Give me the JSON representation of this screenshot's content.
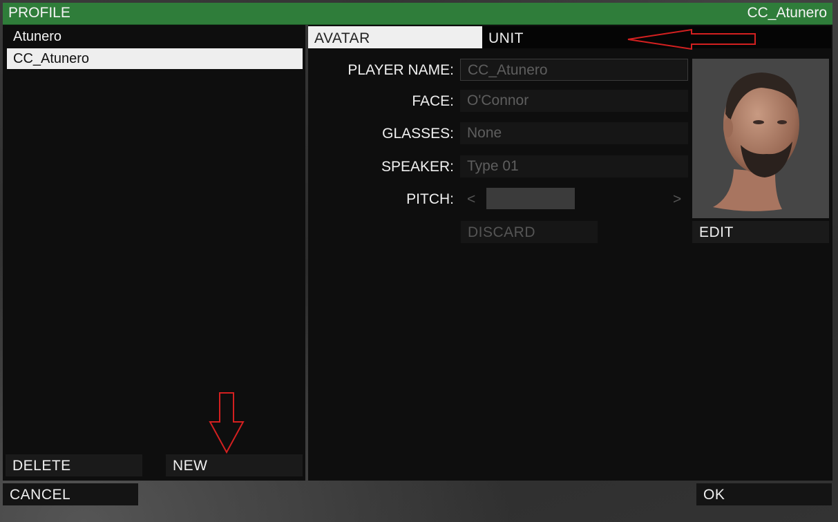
{
  "title": {
    "left": "PROFILE",
    "right": "CC_Atunero"
  },
  "profiles": [
    {
      "name": "Atunero",
      "selected": false
    },
    {
      "name": "CC_Atunero",
      "selected": true
    }
  ],
  "left_buttons": {
    "delete": "DELETE",
    "new": "NEW"
  },
  "tabs": {
    "avatar": "AVATAR",
    "unit": "UNIT"
  },
  "form": {
    "player_name_label": "PLAYER NAME:",
    "player_name_value": "CC_Atunero",
    "face_label": "FACE:",
    "face_value": "O'Connor",
    "glasses_label": "GLASSES:",
    "glasses_value": "None",
    "speaker_label": "SPEAKER:",
    "speaker_value": "Type 01",
    "pitch_label": "PITCH:",
    "pitch_prev": "<",
    "pitch_next": ">",
    "discard": "DISCARD",
    "edit": "EDIT"
  },
  "bottom": {
    "cancel": "CANCEL",
    "ok": "OK"
  },
  "colors": {
    "title_bar": "#2f7d3a",
    "annotation_arrow": "#d42020",
    "panel_bg": "#0e0e0e"
  }
}
